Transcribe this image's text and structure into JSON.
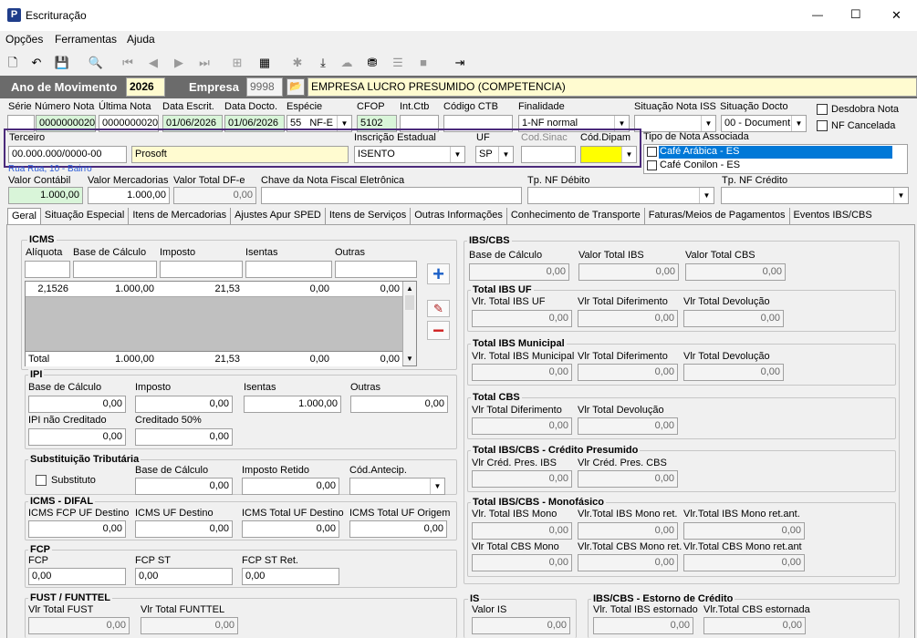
{
  "window": {
    "title": "Escrituração",
    "minimize": "—",
    "maximize": "☐",
    "close": "✕"
  },
  "menu": [
    "Opções",
    "Ferramentas",
    "Ajuda"
  ],
  "header": {
    "ano_label": "Ano de Movimento",
    "ano": "2026",
    "empresa_label": "Empresa",
    "empresa_code": "9998",
    "empresa_name": "EMPRESA LUCRO PRESUMIDO (COMPETENCIA)"
  },
  "row1": {
    "serie_lbl": "Série",
    "num_nota_lbl": "Número Nota",
    "num_nota": "0000000020",
    "ultima_nota_lbl": "Última Nota",
    "ultima_nota": "0000000020",
    "data_escrit_lbl": "Data Escrit.",
    "data_escrit": "01/06/2026",
    "data_docto_lbl": "Data Docto.",
    "data_docto": "01/06/2026",
    "especie_lbl": "Espécie",
    "especie_num": "55",
    "especie": "NF-E",
    "cfop_lbl": "CFOP",
    "cfop": "5102",
    "int_ctb_lbl": "Int.Ctb",
    "codigo_ctb_lbl": "Código CTB",
    "finalidade_lbl": "Finalidade",
    "finalidade": "1-NF normal",
    "sit_iss_lbl": "Situação Nota ISS",
    "sit_docto_lbl": "Situação Docto",
    "sit_docto": "00 - Document",
    "desdobra": "Desdobra Nota",
    "cancelada": "NF Cancelada"
  },
  "row2": {
    "terceiro_lbl": "Terceiro",
    "cnpj": "00.000.000/0000-00",
    "terceiro_nome": "Prosoft",
    "ie_lbl": "Inscrição Estadual",
    "ie": "ISENTO",
    "uf_lbl": "UF",
    "uf": "SP",
    "sinac_lbl": "Cod.Sinac",
    "dipam_lbl": "Cód.Dipam",
    "tipo_nota_lbl": "Tipo de Nota Associada",
    "tipo_nota_items": [
      "Café Arábica - ES",
      "Café Conilon - ES"
    ],
    "endereco": "Rua Rua, 10 - Bairro"
  },
  "row3": {
    "valor_contabil_lbl": "Valor Contábil",
    "valor_contabil": "1.000,00",
    "valor_merc_lbl": "Valor Mercadorias",
    "valor_merc": "1.000,00",
    "valor_dfe_lbl": "Valor Total DF-e",
    "valor_dfe": "0,00",
    "chave_lbl": "Chave da Nota Fiscal Eletrônica",
    "tp_debito_lbl": "Tp. NF Débito",
    "tp_credito_lbl": "Tp. NF Crédito"
  },
  "tabs": [
    "Geral",
    "Situação Especial",
    "Itens de Mercadorias",
    "Ajustes Apur SPED",
    "Itens de Serviços",
    "Outras Informações",
    "Conhecimento de Transporte",
    "Faturas/Meios de Pagamentos",
    "Eventos IBS/CBS"
  ],
  "icms": {
    "title": "ICMS",
    "aliquota": "Alíquota",
    "base": "Base de Cálculo",
    "imposto": "Imposto",
    "isentas": "Isentas",
    "outras": "Outras",
    "row": [
      "2,1526",
      "1.000,00",
      "21,53",
      "0,00",
      "0,00"
    ],
    "total_lbl": "Total",
    "total": [
      "1.000,00",
      "21,53",
      "0,00",
      "0,00"
    ]
  },
  "ipi": {
    "title": "IPI",
    "base": "Base de Cálculo",
    "base_v": "0,00",
    "imposto": "Imposto",
    "imposto_v": "0,00",
    "isentas": "Isentas",
    "isentas_v": "1.000,00",
    "outras": "Outras",
    "outras_v": "0,00",
    "nao_cred": "IPI não Creditado",
    "nao_cred_v": "0,00",
    "cred50": "Creditado 50%",
    "cred50_v": "0,00"
  },
  "st": {
    "title": "Substituição Tributária",
    "substituto": "Substituto",
    "base": "Base de Cálculo",
    "base_v": "0,00",
    "retido": "Imposto Retido",
    "retido_v": "0,00",
    "antecip": "Cód.Antecip."
  },
  "difal": {
    "title": "ICMS - DIFAL",
    "fcp": "ICMS FCP UF Destino",
    "fcp_v": "0,00",
    "uf_dest": "ICMS UF Destino",
    "uf_dest_v": "0,00",
    "total_dest": "ICMS Total UF Destino",
    "total_dest_v": "0,00",
    "total_orig": "ICMS Total UF Origem",
    "total_orig_v": "0,00"
  },
  "fcp": {
    "title": "FCP",
    "fcp": "FCP",
    "fcp_v": "0,00",
    "fcp_st": "FCP ST",
    "fcp_st_v": "0,00",
    "fcp_st_ret": "FCP ST Ret.",
    "fcp_st_ret_v": "0,00"
  },
  "fust": {
    "title": "FUST / FUNTTEL",
    "fust": "Vlr Total FUST",
    "fust_v": "0,00",
    "funttel": "Vlr Total FUNTTEL",
    "funttel_v": "0,00"
  },
  "ibscbs": {
    "title": "IBS/CBS",
    "base": "Base de Cálculo",
    "base_v": "0,00",
    "ibs": "Valor Total IBS",
    "ibs_v": "0,00",
    "cbs": "Valor Total CBS",
    "cbs_v": "0,00"
  },
  "ibs_uf": {
    "title": "Total IBS UF",
    "a": "Vlr. Total IBS UF",
    "a_v": "0,00",
    "b": "Vlr Total Diferimento",
    "b_v": "0,00",
    "c": "Vlr Total Devolução",
    "c_v": "0,00"
  },
  "ibs_mun": {
    "title": "Total IBS Municipal",
    "a": "Vlr. Total IBS Municipal",
    "a_v": "0,00",
    "b": "Vlr Total Diferimento",
    "b_v": "0,00",
    "c": "Vlr Total Devolução",
    "c_v": "0,00"
  },
  "cbs": {
    "title": "Total CBS",
    "a": "Vlr Total Diferimento",
    "a_v": "0,00",
    "b": "Vlr Total Devolução",
    "b_v": "0,00"
  },
  "cred_pres": {
    "title": "Total IBS/CBS - Crédito Presumido",
    "a": "Vlr Créd. Pres. IBS",
    "a_v": "0,00",
    "b": "Vlr Créd. Pres. CBS",
    "b_v": "0,00"
  },
  "mono": {
    "title": "Total IBS/CBS - Monofásico",
    "a": "Vlr. Total IBS Mono",
    "a_v": "0,00",
    "b": "Vlr.Total IBS Mono ret.",
    "b_v": "0,00",
    "c": "Vlr.Total IBS Mono ret.ant.",
    "c_v": "0,00",
    "d": "Vlr Total CBS Mono",
    "d_v": "0,00",
    "e": "Vlr.Total CBS Mono ret.",
    "e_v": "0,00",
    "f": "Vlr.Total CBS Mono ret.ant",
    "f_v": "0,00"
  },
  "is": {
    "title": "IS",
    "a": "Valor IS",
    "a_v": "0,00"
  },
  "estorno": {
    "title": "IBS/CBS - Estorno de Crédito",
    "a": "Vlr. Total IBS estornado",
    "a_v": "0,00",
    "b": "Vlr.Total CBS estornada",
    "b_v": "0,00"
  }
}
